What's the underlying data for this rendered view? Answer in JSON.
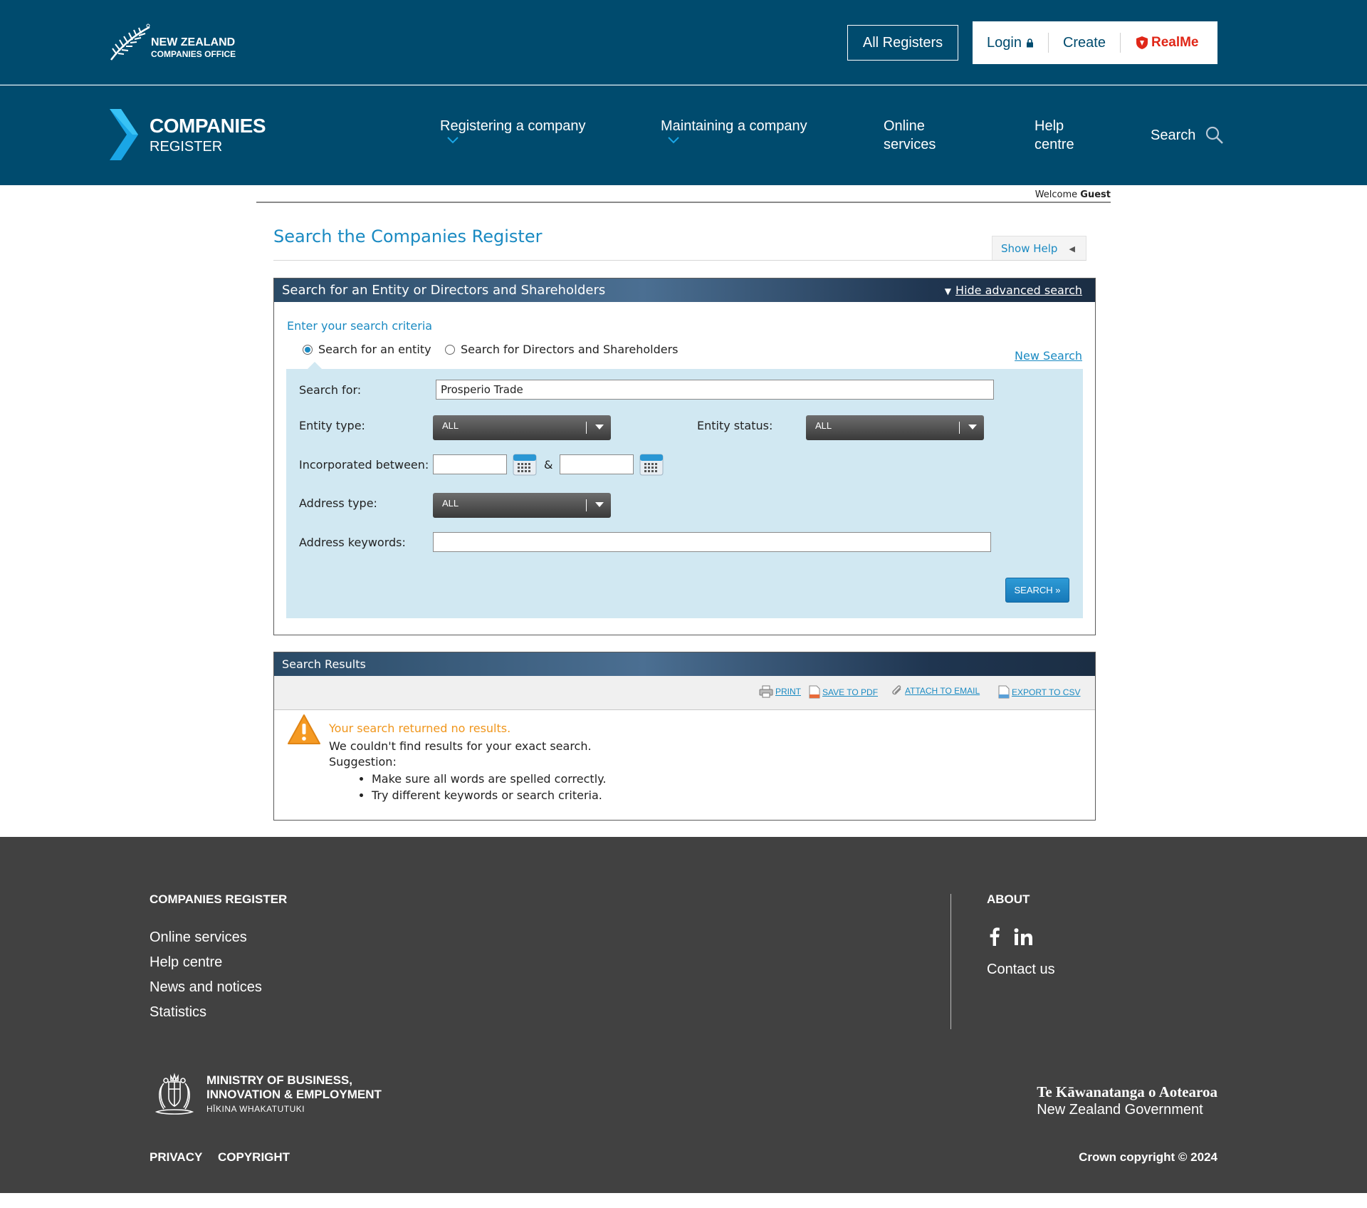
{
  "topbar": {
    "logo_line1": "NEW ZEALAND",
    "logo_line2": "COMPANIES OFFICE",
    "all_registers": "All Registers",
    "login": "Login",
    "create": "Create",
    "realme": "RealMe"
  },
  "nav": {
    "brand_line1": "COMPANIES",
    "brand_line2": "REGISTER",
    "items": [
      {
        "label": "Registering a company"
      },
      {
        "label": "Maintaining a company"
      },
      {
        "label_l1": "Online",
        "label_l2": "services"
      },
      {
        "label_l1": "Help",
        "label_l2": "centre"
      },
      {
        "label": "Search"
      }
    ]
  },
  "welcome": {
    "prefix": "Welcome",
    "user": "Guest"
  },
  "page": {
    "title": "Search the Companies Register",
    "show_help": "Show Help"
  },
  "search_panel": {
    "header": "Search for an Entity or Directors and Shareholders",
    "hide_advanced": "Hide advanced search",
    "criteria_label": "Enter your search criteria",
    "radio_entity": "Search for an entity",
    "radio_directors": "Search for Directors and Shareholders",
    "selected_radio": "entity",
    "new_search": "New Search",
    "search_for_label": "Search for:",
    "search_for_value": "Prosperio Trade",
    "entity_type_label": "Entity type:",
    "entity_type_value": "ALL",
    "entity_status_label": "Entity status:",
    "entity_status_value": "ALL",
    "incorporated_label": "Incorporated between:",
    "incorporated_from": "",
    "incorporated_to": "",
    "amp": "&",
    "address_type_label": "Address type:",
    "address_type_value": "ALL",
    "address_keywords_label": "Address keywords:",
    "address_keywords_value": "",
    "search_button": "SEARCH »"
  },
  "results_panel": {
    "header": "Search Results",
    "tools": {
      "print": "PRINT",
      "save_pdf": "SAVE TO PDF",
      "attach_email": "ATTACH TO EMAIL",
      "export_csv": "EXPORT TO CSV"
    },
    "no_results_title": "Your search returned no results.",
    "no_results_sub": "We couldn't find results for your exact search.",
    "suggestion": "Suggestion:",
    "tips": [
      "Make sure all words are spelled correctly.",
      "Try different keywords or search criteria."
    ]
  },
  "footer": {
    "col1_heading": "COMPANIES REGISTER",
    "col1_links": [
      "Online services",
      "Help centre",
      "News and notices",
      "Statistics"
    ],
    "col2_heading": "ABOUT",
    "contact": "Contact us",
    "mbie_line1": "MINISTRY OF BUSINESS,",
    "mbie_line2": "INNOVATION & EMPLOYMENT",
    "mbie_line3": "HĪKINA WHAKATUTUKI",
    "nzgov_line1": "Te Kāwanatanga o Aotearoa",
    "nzgov_line2": "New Zealand Government",
    "privacy": "PRIVACY",
    "copyright": "COPYRIGHT",
    "crown": "Crown copyright © 2024"
  }
}
